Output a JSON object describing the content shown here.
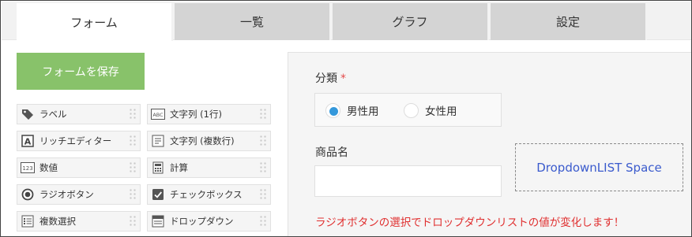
{
  "tabs": [
    {
      "label": "フォーム",
      "active": true
    },
    {
      "label": "一覧",
      "active": false
    },
    {
      "label": "グラフ",
      "active": false
    },
    {
      "label": "設定",
      "active": false
    }
  ],
  "palette": {
    "save_label": "フォームを保存",
    "items": [
      {
        "label": "ラベル",
        "icon": "tag-icon"
      },
      {
        "label": "文字列 (1行)",
        "icon": "abc-icon"
      },
      {
        "label": "リッチエディター",
        "icon": "rich-editor-icon"
      },
      {
        "label": "文字列 (複数行)",
        "icon": "multiline-icon"
      },
      {
        "label": "数値",
        "icon": "number-123-icon"
      },
      {
        "label": "計算",
        "icon": "calculator-icon"
      },
      {
        "label": "ラジオボタン",
        "icon": "radio-icon"
      },
      {
        "label": "チェックボックス",
        "icon": "checkbox-icon"
      },
      {
        "label": "複数選択",
        "icon": "multi-select-icon"
      },
      {
        "label": "ドロップダウン",
        "icon": "dropdown-icon"
      }
    ]
  },
  "form": {
    "category_label": "分類",
    "required_mark": "*",
    "radio_options": [
      {
        "label": "男性用",
        "selected": true
      },
      {
        "label": "女性用",
        "selected": false
      }
    ],
    "product_label": "商品名",
    "product_value": "",
    "space_label": "DropdownLIST Space",
    "note": "ラジオボタンの選択でドロップダウンリストの値が変化します！"
  },
  "colors": {
    "save_button": "#88c26a",
    "required": "#e34b4b",
    "radio_selected": "#3498db",
    "space_text": "#3b5bcd",
    "note_text": "#e03030"
  }
}
